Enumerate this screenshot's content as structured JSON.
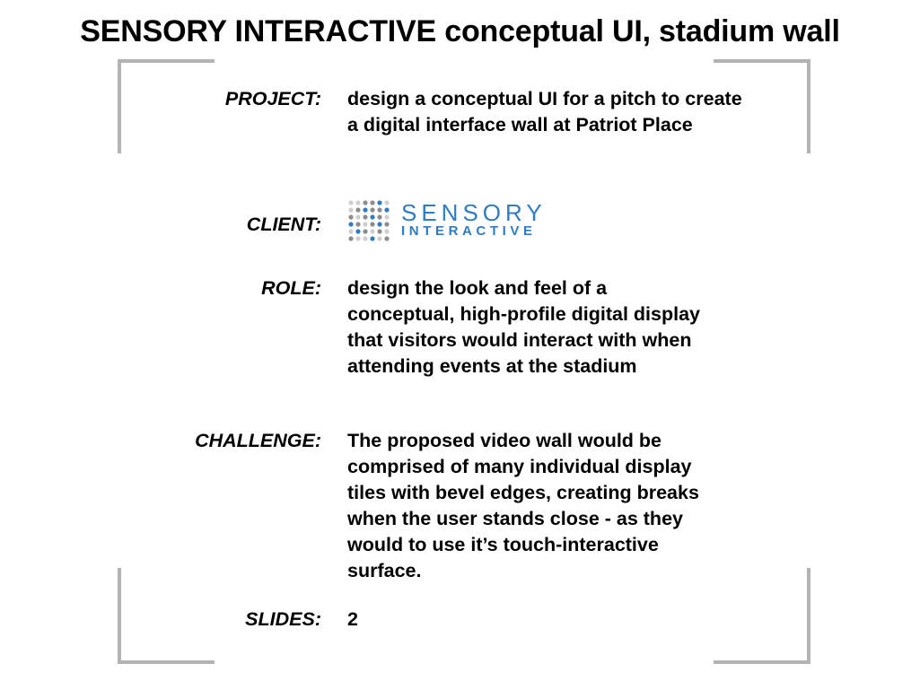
{
  "title": "SENSORY INTERACTIVE conceptual UI, stadium wall",
  "colors": {
    "bracket": "#b3b3b3",
    "logo_blue": "#2f7cc4",
    "dot_gray_dark": "#8c8c8c",
    "dot_gray_light": "#cfcfcf"
  },
  "fields": {
    "project": {
      "label": "PROJECT:",
      "value": "design a conceptual UI for a pitch to create a digital interface wall at Patriot Place"
    },
    "client": {
      "label": "CLIENT:",
      "logo": {
        "icon": "dot-grid-logo-icon",
        "line1": "SENSORY",
        "line2": "INTERACTIVE"
      }
    },
    "role": {
      "label": "ROLE:",
      "value": "design the look and feel of a conceptual, high-profile digital display that visitors would interact with when attending events at the stadium"
    },
    "challenge": {
      "label": "CHALLENGE:",
      "value": "The proposed video wall would be comprised of many individual display tiles with bevel edges, creating breaks when the user stands close - as they would to use it’s touch-interactive surface."
    },
    "slides": {
      "label": "SLIDES:",
      "value": "2"
    }
  }
}
